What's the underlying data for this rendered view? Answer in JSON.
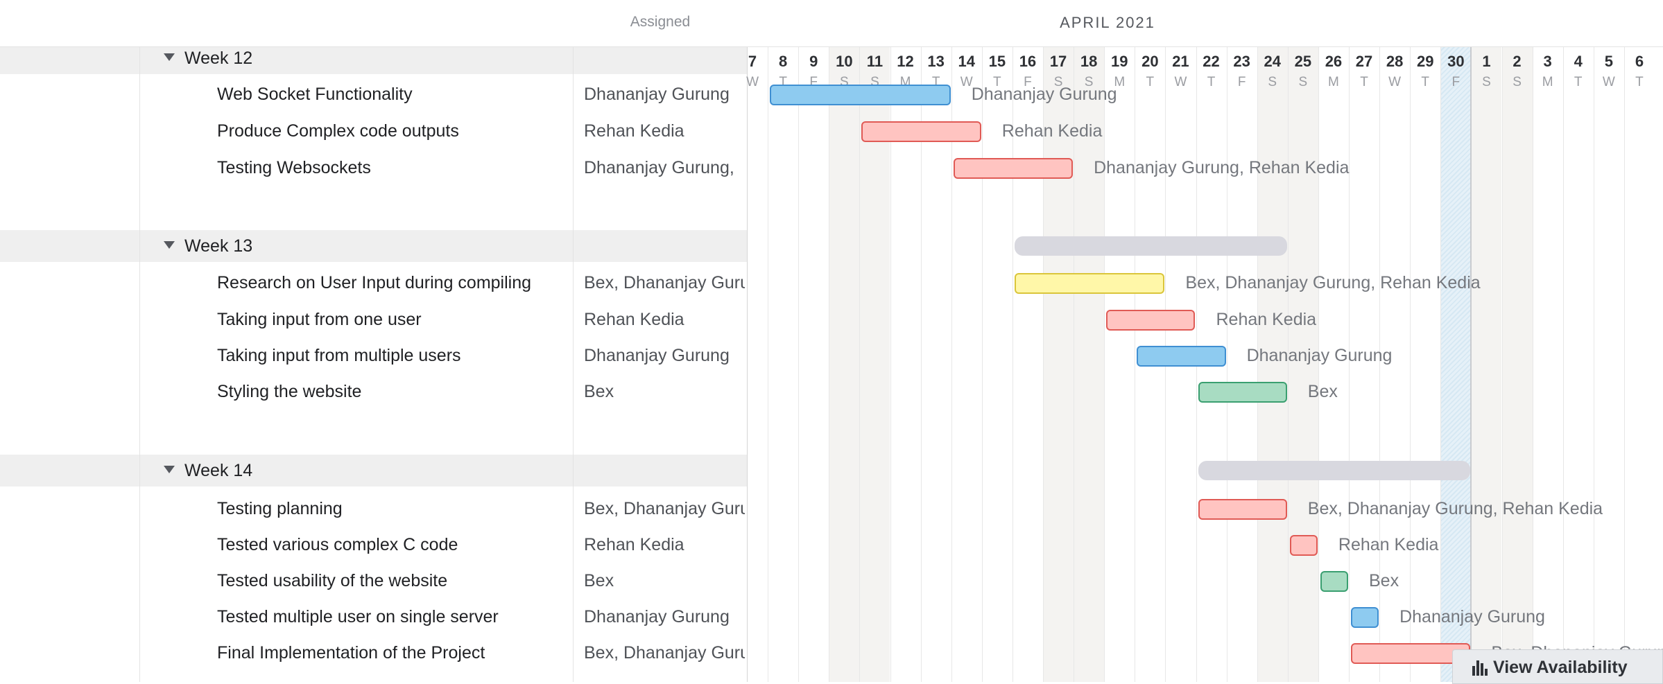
{
  "header": {
    "assigned_label": "Assigned",
    "month_label": "APRIL 2021"
  },
  "groups": [
    {
      "label": "Week 12",
      "tasks": [
        {
          "name": "Web Socket Functionality",
          "assigned": "Dhananjay Gurung",
          "start": 8,
          "end": 13,
          "color": "blue",
          "bar_label": "Dhananjay Gurung"
        },
        {
          "name": "Produce Complex code outputs",
          "assigned": "Rehan Kedia",
          "start": 11,
          "end": 14,
          "color": "red",
          "bar_label": "Rehan Kedia"
        },
        {
          "name": "Testing Websockets",
          "assigned": "Dhananjay Gurung,",
          "start": 14,
          "end": 17,
          "color": "red",
          "bar_label": "Dhananjay Gurung, Rehan Kedia"
        }
      ]
    },
    {
      "label": "Week 13",
      "summary": {
        "start": 16,
        "end": 24
      },
      "tasks": [
        {
          "name": "Research on User Input during compiling",
          "assigned": "Bex, Dhananjay Gurung, Rehan Kedia",
          "start": 16,
          "end": 20,
          "color": "yellow",
          "bar_label": "Bex, Dhananjay Gurung, Rehan Kedia"
        },
        {
          "name": "Taking input from one user",
          "assigned": "Rehan Kedia",
          "start": 19,
          "end": 21,
          "color": "red",
          "bar_label": "Rehan Kedia"
        },
        {
          "name": "Taking input from multiple users",
          "assigned": "Dhananjay Gurung",
          "start": 20,
          "end": 22,
          "color": "blue",
          "bar_label": "Dhananjay Gurung"
        },
        {
          "name": "Styling the website",
          "assigned": "Bex",
          "start": 22,
          "end": 24,
          "color": "green",
          "bar_label": "Bex"
        }
      ]
    },
    {
      "label": "Week 14",
      "summary": {
        "start": 22,
        "end": 30
      },
      "tasks": [
        {
          "name": "Testing planning",
          "assigned": "Bex, Dhananjay Gurung, Rehan Kedia",
          "start": 22,
          "end": 24,
          "color": "red",
          "bar_label": "Bex, Dhananjay Gurung, Rehan Kedia"
        },
        {
          "name": "Tested various complex C code",
          "assigned": "Rehan Kedia",
          "start": 25,
          "end": 25,
          "color": "red",
          "bar_label": "Rehan Kedia"
        },
        {
          "name": "Tested usability of the website",
          "assigned": "Bex",
          "start": 26,
          "end": 26,
          "color": "green",
          "bar_label": "Bex"
        },
        {
          "name": "Tested multiple user on single server",
          "assigned": "Dhananjay Gurung",
          "start": 27,
          "end": 27,
          "color": "blue",
          "bar_label": "Dhananjay Gurung"
        },
        {
          "name": "Final Implementation of the Project",
          "assigned": "Bex, Dhananjay Gurung, Rehan Kedia",
          "start": 27,
          "end": 30,
          "color": "red",
          "bar_label": "Bex, Dhananjay Gurung"
        }
      ]
    }
  ],
  "days": [
    {
      "n": "7",
      "d": "W"
    },
    {
      "n": "8",
      "d": "T"
    },
    {
      "n": "9",
      "d": "F"
    },
    {
      "n": "10",
      "d": "S"
    },
    {
      "n": "11",
      "d": "S"
    },
    {
      "n": "12",
      "d": "M"
    },
    {
      "n": "13",
      "d": "T"
    },
    {
      "n": "14",
      "d": "W"
    },
    {
      "n": "15",
      "d": "T"
    },
    {
      "n": "16",
      "d": "F"
    },
    {
      "n": "17",
      "d": "S"
    },
    {
      "n": "18",
      "d": "S"
    },
    {
      "n": "19",
      "d": "M"
    },
    {
      "n": "20",
      "d": "T"
    },
    {
      "n": "21",
      "d": "W"
    },
    {
      "n": "22",
      "d": "T"
    },
    {
      "n": "23",
      "d": "F"
    },
    {
      "n": "24",
      "d": "S"
    },
    {
      "n": "25",
      "d": "S"
    },
    {
      "n": "26",
      "d": "M"
    },
    {
      "n": "27",
      "d": "T"
    },
    {
      "n": "28",
      "d": "W"
    },
    {
      "n": "29",
      "d": "T"
    },
    {
      "n": "30",
      "d": "F"
    },
    {
      "n": "1",
      "d": "S"
    },
    {
      "n": "2",
      "d": "S"
    },
    {
      "n": "3",
      "d": "M"
    },
    {
      "n": "4",
      "d": "T"
    },
    {
      "n": "5",
      "d": "W"
    },
    {
      "n": "6",
      "d": "T"
    }
  ],
  "today": "30",
  "colors": {
    "blue": "#8ecbf0",
    "red": "#ffc4c1",
    "yellow": "#fff7a8",
    "green": "#a8dcc2",
    "summary": "#d8d8df"
  },
  "footer": {
    "view_availability_label": "View Availability",
    "icon": "bar-chart-icon"
  }
}
